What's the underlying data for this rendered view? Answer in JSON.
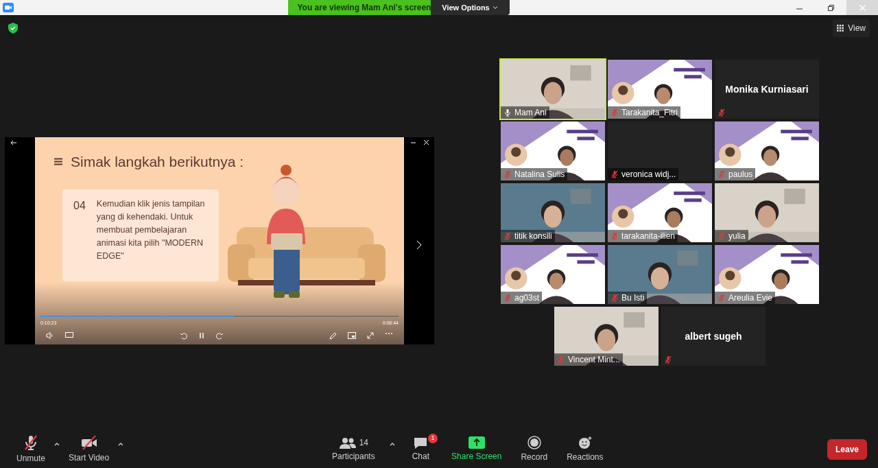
{
  "banner": {
    "text": "You are viewing Mam Ani's screen",
    "options": "View Options"
  },
  "view_button": "View",
  "shared_screen": {
    "slide_title": "Simak langkah berikutnya :",
    "step_number": "04",
    "step_text": "Kemudian  klik jenis tampilan yang di kehendaki.  Untuk membuat pembelajaran animasi kita pilih \"MODERN EDGE\"",
    "elapsed": "0:10:23",
    "remaining": "0:08:44",
    "level": 0.54
  },
  "participants": [
    {
      "name": "Mam Ani",
      "kind": "video",
      "muted": false,
      "speaking": true
    },
    {
      "name": "Tarakanita_Fitri",
      "kind": "video",
      "muted": true,
      "speaking": false
    },
    {
      "name": "Monika Kurniasari",
      "kind": "name",
      "muted": true,
      "speaking": false
    },
    {
      "name": "Natalina Sulis",
      "kind": "video",
      "muted": true,
      "speaking": false
    },
    {
      "name": "veronica widj...",
      "kind": "blank",
      "muted": true,
      "speaking": false
    },
    {
      "name": "paulus",
      "kind": "video",
      "muted": true,
      "speaking": false
    },
    {
      "name": "titik konsili",
      "kind": "video",
      "muted": true,
      "speaking": false
    },
    {
      "name": "tarakanita-ilien",
      "kind": "video",
      "muted": true,
      "speaking": false
    },
    {
      "name": "yulia",
      "kind": "video",
      "muted": true,
      "speaking": false
    },
    {
      "name": "ag03st",
      "kind": "video",
      "muted": true,
      "speaking": false
    },
    {
      "name": "Bu Isti",
      "kind": "video",
      "muted": true,
      "speaking": false
    },
    {
      "name": "Areulia Evie",
      "kind": "video",
      "muted": true,
      "speaking": false
    },
    {
      "name": "Vincent Mint...",
      "kind": "video",
      "muted": true,
      "speaking": false
    },
    {
      "name": "albert sugeh",
      "kind": "name",
      "muted": true,
      "speaking": false
    }
  ],
  "toolbar": {
    "unmute": "Unmute",
    "start_video": "Start Video",
    "participant_count": "14",
    "participants": "Participants",
    "chat": "Chat",
    "chat_badge": "1",
    "share_screen": "Share Screen",
    "record": "Record",
    "reactions": "Reactions",
    "leave": "Leave"
  }
}
